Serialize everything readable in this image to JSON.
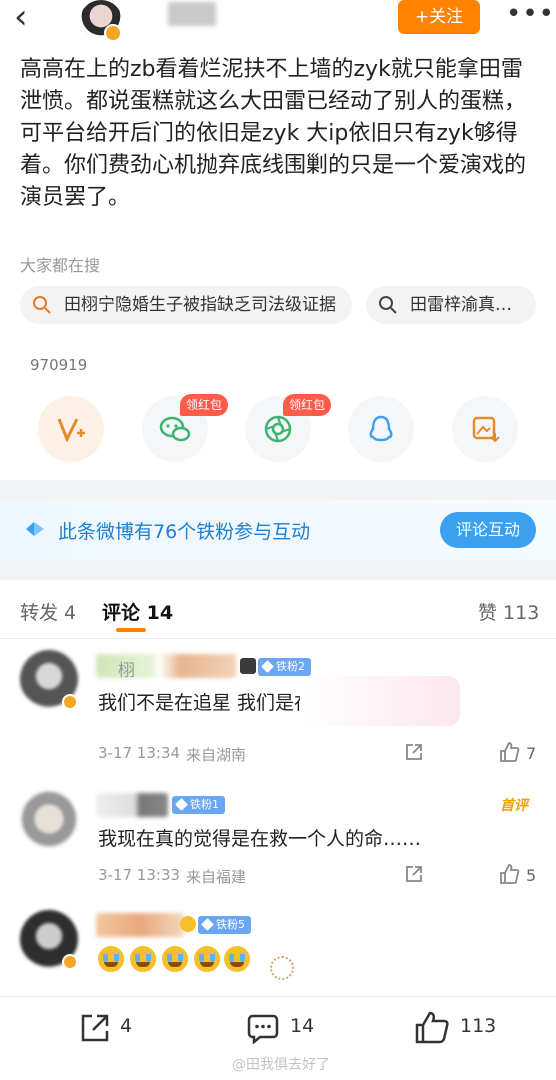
{
  "header": {
    "follow_label": "+关注"
  },
  "post": {
    "text": "高高在上的zb看着烂泥扶不上墙的zyk就只能拿田雷泄愤。都说蛋糕就这么大田雷已经动了别人的蛋糕，可平台给开后门的依旧是zyk 大ip依旧只有zyk够得着。你们费劲心机抛弃底线围剿的只是一个爱演戏的演员罢了。"
  },
  "search": {
    "label": "大家都在搜",
    "chips": [
      "田栩宁隐婚生子被指缺乏司法级证据",
      "田雷梓渝真…"
    ]
  },
  "views": "970919",
  "share": {
    "red_packet_label": "领红包"
  },
  "iron_fans": {
    "text": "此条微博有76个铁粉参与互动",
    "button": "评论互动"
  },
  "tabs": {
    "repost": "转发 4",
    "comment": "评论 14",
    "like": "赞 113"
  },
  "comments": [
    {
      "name_frag": "栩",
      "fan_badge": "铁粉2",
      "text": "我们不是在追星 我们是在救人",
      "time": "3-17 13:34",
      "location": "来自湖南",
      "likes": "7"
    },
    {
      "fan_badge": "铁粉1",
      "first_label": "首评",
      "text": "我现在真的觉得是在救一个人的命……",
      "time": "3-17 13:33",
      "location": "来自福建",
      "likes": "5"
    },
    {
      "fan_badge": "铁粉5"
    }
  ],
  "bottom": {
    "repost": "4",
    "comment": "14",
    "like": "113"
  },
  "watermark": "@田我俱去好了",
  "colors": {
    "accent": "#ff8200",
    "link": "#1e7fd1",
    "fan_badge": "#6aa7f0",
    "red_packet": "#ff5b49"
  }
}
